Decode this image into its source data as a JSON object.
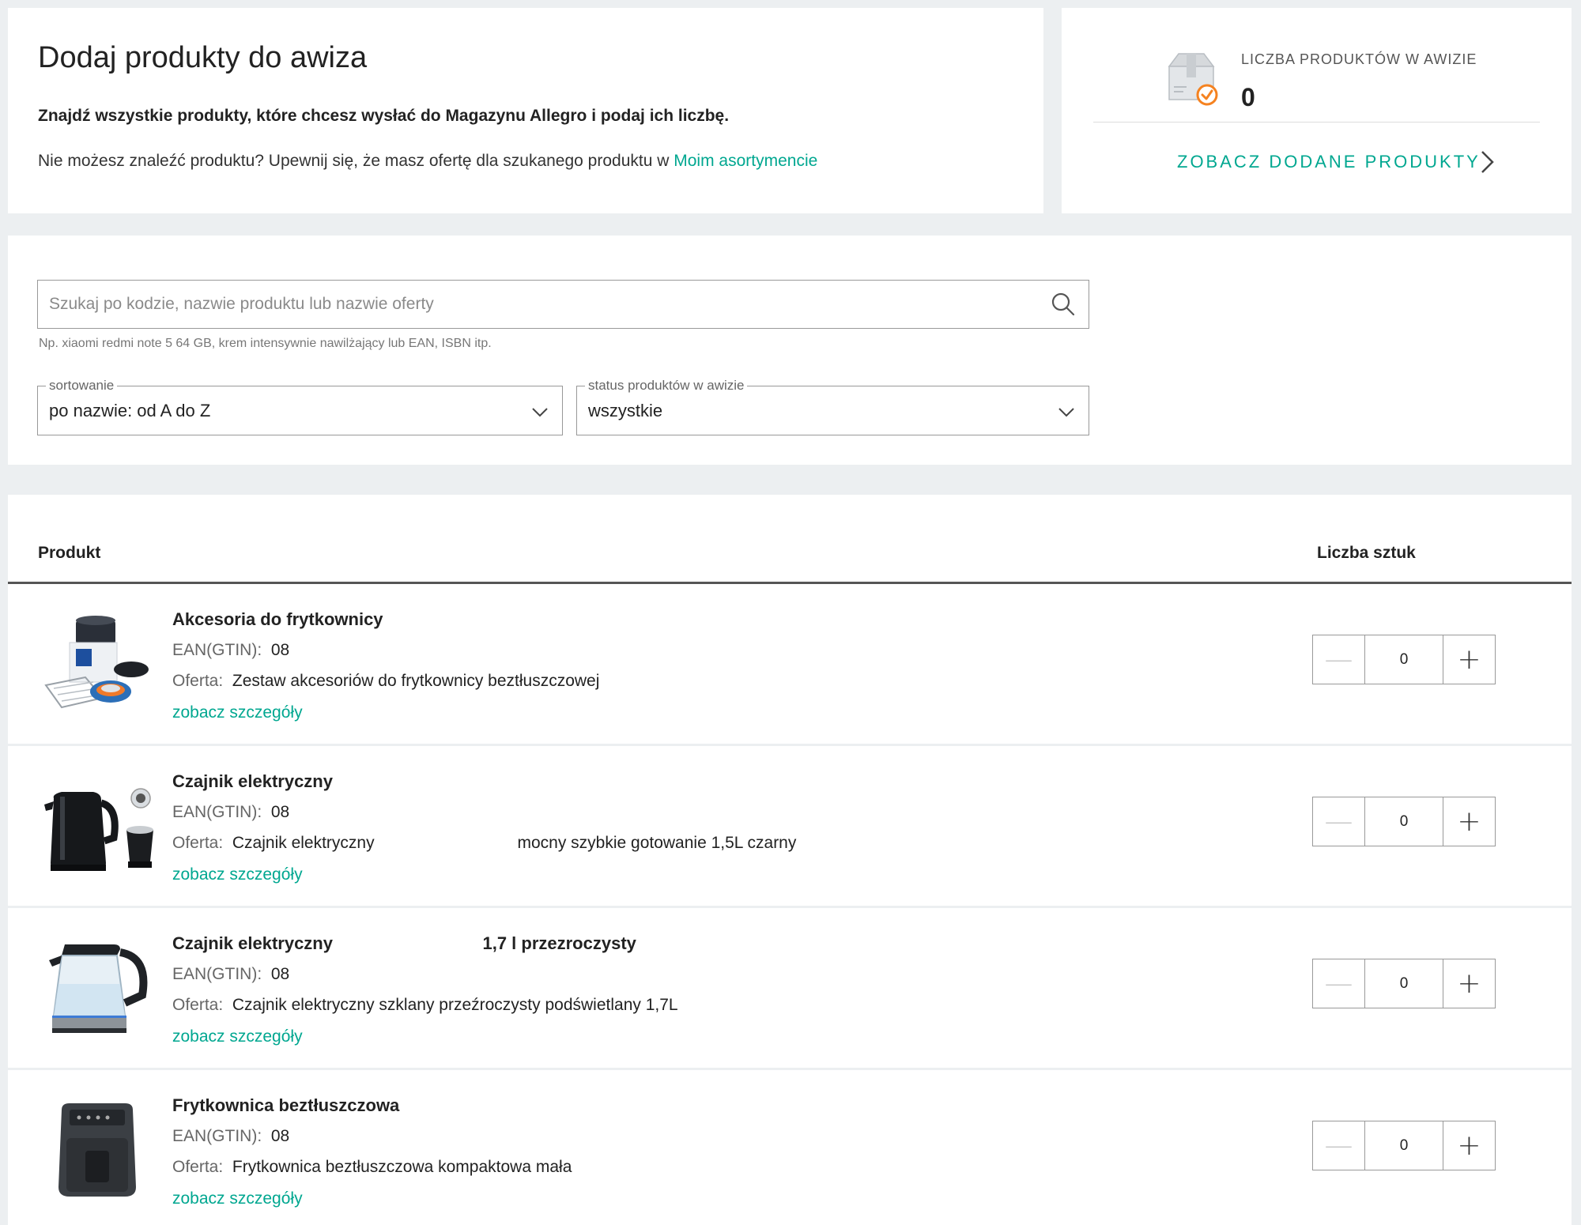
{
  "intro": {
    "title": "Dodaj produkty do awiza",
    "subtitle": "Znajdź wszystkie produkty, które chcesz wysłać do Magazynu Allegro i podaj ich liczbę.",
    "info_text": "Nie możesz znaleźć produktu? Upewnij się, że masz ofertę dla szukanego produktu w ",
    "info_link": "Moim asortymencie"
  },
  "summary": {
    "label": "LICZBA PRODUKTÓW W AWIZIE",
    "count": "0",
    "link": "ZOBACZ DODANE PRODUKTY",
    "icon": "box-check-icon"
  },
  "search": {
    "placeholder": "Szukaj po kodzie, nazwie produktu lub nazwie oferty",
    "hint": "Np. xiaomi redmi note 5 64 GB, krem intensywnie nawilżający lub EAN, ISBN itp."
  },
  "filters": {
    "sort": {
      "label": "sortowanie",
      "value": "po nazwie: od A do Z"
    },
    "status": {
      "label": "status produktów w awizie",
      "value": "wszystkie"
    }
  },
  "table": {
    "col_product": "Produkt",
    "col_qty": "Liczba sztuk",
    "ean_label": "EAN(GTIN):",
    "offer_label": "Oferta:",
    "details_label": "zobacz szczegóły",
    "rows": [
      {
        "name": "Akcesoria do frytkownicy",
        "ean": "08",
        "offer": "Zestaw akcesoriów do frytkownicy beztłuszczowej",
        "qty": "0",
        "image": "fryer-accessories-image"
      },
      {
        "name": "Czajnik elektryczny",
        "ean": "08",
        "offer": "Czajnik elektryczny                               mocny szybkie gotowanie 1,5L czarny",
        "qty": "0",
        "image": "black-kettle-image"
      },
      {
        "name": "Czajnik elektryczny                               1,7 l przezroczysty",
        "ean": "08",
        "offer": "Czajnik elektryczny szklany przeźroczysty podświetlany 1,7L",
        "qty": "0",
        "image": "glass-kettle-image"
      },
      {
        "name": "Frytkownica beztłuszczowa",
        "ean": "08",
        "offer": "Frytkownica beztłuszczowa kompaktowa mała",
        "qty": "0",
        "image": "air-fryer-image"
      }
    ]
  },
  "colors": {
    "accent": "#00a790",
    "background": "#eceff1",
    "badge": "#f58220"
  }
}
